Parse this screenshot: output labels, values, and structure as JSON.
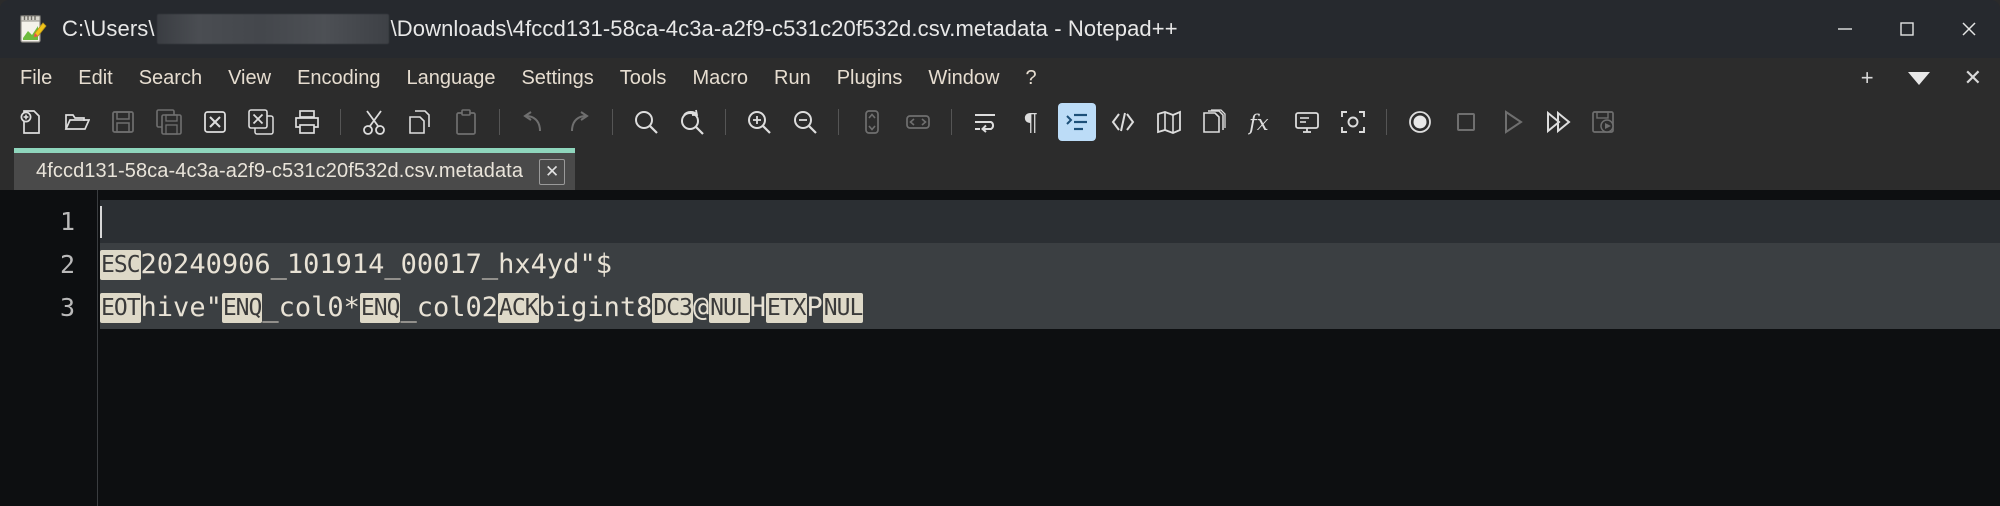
{
  "window": {
    "app_name": "Notepad++",
    "title_prefix": "C:\\Users\\",
    "title_suffix": "\\Downloads\\4fccd131-58ca-4c3a-a2f9-c531c20f532d.csv.metadata - Notepad++",
    "redacted_username": "",
    "controls": {
      "minimize": "—",
      "maximize": "☐",
      "close": "✕"
    }
  },
  "menubar": {
    "items": [
      "File",
      "Edit",
      "Search",
      "View",
      "Encoding",
      "Language",
      "Settings",
      "Tools",
      "Macro",
      "Run",
      "Plugins",
      "Window",
      "?"
    ],
    "right": {
      "add": "+",
      "dropdown": "▼",
      "close": "✕"
    }
  },
  "toolbar": {
    "items": [
      {
        "name": "new-file-icon",
        "label": "New",
        "state": "enabled"
      },
      {
        "name": "open-file-icon",
        "label": "Open",
        "state": "enabled"
      },
      {
        "name": "save-icon",
        "label": "Save",
        "state": "disabled"
      },
      {
        "name": "save-all-icon",
        "label": "Save All",
        "state": "disabled"
      },
      {
        "name": "close-file-icon",
        "label": "Close",
        "state": "enabled"
      },
      {
        "name": "close-all-icon",
        "label": "Close All",
        "state": "enabled"
      },
      {
        "name": "print-icon",
        "label": "Print",
        "state": "enabled"
      },
      {
        "name": "separator",
        "label": "",
        "state": "sep"
      },
      {
        "name": "cut-icon",
        "label": "Cut",
        "state": "enabled"
      },
      {
        "name": "copy-icon",
        "label": "Copy",
        "state": "enabled"
      },
      {
        "name": "paste-icon",
        "label": "Paste",
        "state": "disabled"
      },
      {
        "name": "separator",
        "label": "",
        "state": "sep"
      },
      {
        "name": "undo-icon",
        "label": "Undo",
        "state": "disabled"
      },
      {
        "name": "redo-icon",
        "label": "Redo",
        "state": "disabled"
      },
      {
        "name": "separator",
        "label": "",
        "state": "sep"
      },
      {
        "name": "find-icon",
        "label": "Find",
        "state": "enabled"
      },
      {
        "name": "replace-icon",
        "label": "Replace",
        "state": "enabled"
      },
      {
        "name": "separator",
        "label": "",
        "state": "sep"
      },
      {
        "name": "zoom-in-icon",
        "label": "Zoom In",
        "state": "enabled"
      },
      {
        "name": "zoom-out-icon",
        "label": "Zoom Out",
        "state": "enabled"
      },
      {
        "name": "separator",
        "label": "",
        "state": "sep"
      },
      {
        "name": "sync-vertical-scroll-icon",
        "label": "Sync Vertical Scrolling",
        "state": "disabled"
      },
      {
        "name": "sync-horizontal-scroll-icon",
        "label": "Sync Horizontal Scrolling",
        "state": "disabled"
      },
      {
        "name": "separator",
        "label": "",
        "state": "sep"
      },
      {
        "name": "word-wrap-icon",
        "label": "Word Wrap",
        "state": "enabled"
      },
      {
        "name": "show-all-characters-icon",
        "label": "Show All Characters",
        "state": "enabled"
      },
      {
        "name": "indent-guide-icon",
        "label": "Show Indent Guide",
        "state": "active"
      },
      {
        "name": "user-defined-language-icon",
        "label": "UserDefine Dialog",
        "state": "enabled"
      },
      {
        "name": "document-map-icon",
        "label": "Document Map",
        "state": "enabled"
      },
      {
        "name": "document-list-icon",
        "label": "Document List",
        "state": "enabled"
      },
      {
        "name": "function-list-icon",
        "label": "Function List",
        "state": "enabled"
      },
      {
        "name": "document-monitor-icon",
        "label": "Monitoring",
        "state": "enabled"
      },
      {
        "name": "distraction-free-icon",
        "label": "Distraction Free Mode",
        "state": "enabled"
      },
      {
        "name": "separator",
        "label": "",
        "state": "sep"
      },
      {
        "name": "macro-record-icon",
        "label": "Start Recording",
        "state": "enabled"
      },
      {
        "name": "macro-stop-icon",
        "label": "Stop Recording",
        "state": "disabled"
      },
      {
        "name": "macro-play-icon",
        "label": "Playback",
        "state": "disabled"
      },
      {
        "name": "macro-run-multiple-icon",
        "label": "Run a Macro Multiple Times",
        "state": "enabled"
      },
      {
        "name": "macro-save-icon",
        "label": "Save Current Recorded Macro",
        "state": "disabled"
      }
    ]
  },
  "tabs": [
    {
      "label": "4fccd131-58ca-4c3a-a2f9-c531c20f532d.csv.metadata",
      "active": true,
      "close_glyph": "✕"
    }
  ],
  "editor": {
    "line_numbers": [
      "1",
      "2",
      "3"
    ],
    "lines": [
      {
        "number": "1",
        "current": true,
        "tokens": []
      },
      {
        "number": "2",
        "current": false,
        "tokens": [
          {
            "type": "control",
            "text": "ESC"
          },
          {
            "type": "text",
            "text": "20240906_101914_00017_hx4yd\"$"
          }
        ]
      },
      {
        "number": "3",
        "current": false,
        "tokens": [
          {
            "type": "control",
            "text": "EOT"
          },
          {
            "type": "text",
            "text": "hive\""
          },
          {
            "type": "control",
            "text": "ENQ"
          },
          {
            "type": "text",
            "text": "_col0*"
          },
          {
            "type": "control",
            "text": "ENQ"
          },
          {
            "type": "text",
            "text": "_col02"
          },
          {
            "type": "control",
            "text": "ACK"
          },
          {
            "type": "text",
            "text": "bigint8"
          },
          {
            "type": "control",
            "text": "DC3"
          },
          {
            "type": "text",
            "text": "@"
          },
          {
            "type": "control",
            "text": "NUL"
          },
          {
            "type": "text",
            "text": "H"
          },
          {
            "type": "control",
            "text": "ETX"
          },
          {
            "type": "text",
            "text": "P"
          },
          {
            "type": "control",
            "text": "NUL"
          }
        ]
      }
    ]
  },
  "colors": {
    "titlebar_bg": "#26292e",
    "menubar_bg": "#2c2c2c",
    "editor_bg": "#0d0f11",
    "tab_active_border": "#8fd6bd",
    "tab_bg": "#4a4a4a",
    "menu_text": "#e6ddd0",
    "control_char_bg": "#ded9c8",
    "indent_guide_active_bg": "#bcdcf7"
  }
}
